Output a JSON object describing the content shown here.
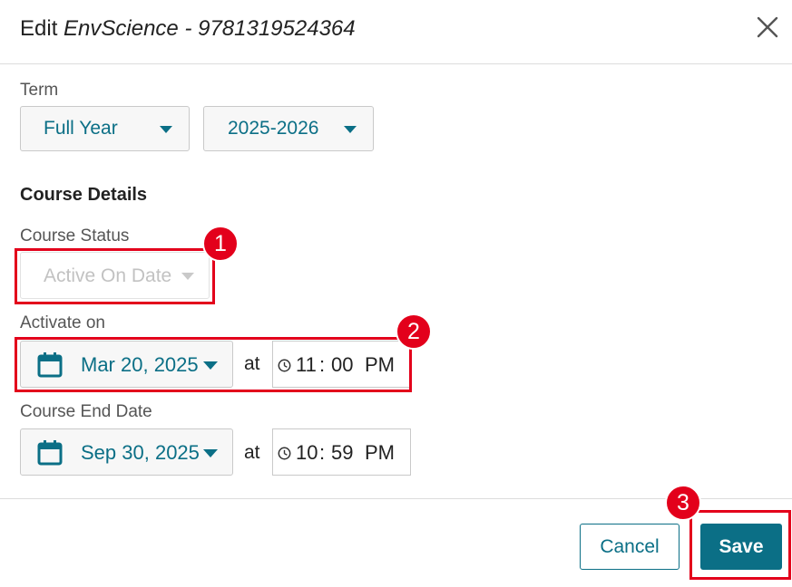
{
  "dialog": {
    "title_prefix": "Edit ",
    "title_name": "EnvScience - 9781319524364"
  },
  "term": {
    "label": "Term",
    "period": "Full Year",
    "year": "2025-2026"
  },
  "course_details": {
    "heading": "Course Details",
    "status_label": "Course Status",
    "status_value": "Active On Date",
    "status_disabled": true
  },
  "activate": {
    "label": "Activate on",
    "date": "Mar 20, 2025",
    "at": "at",
    "hour": "11",
    "sep": ":",
    "minute": "00",
    "ampm": "PM"
  },
  "end": {
    "label": "Course End Date",
    "date": "Sep 30, 2025",
    "at": "at",
    "hour": "10",
    "sep": ":",
    "minute": "59",
    "ampm": "PM"
  },
  "footer": {
    "cancel_label": "Cancel",
    "save_label": "Save"
  },
  "annotations": {
    "badge_1": "1",
    "badge_2": "2",
    "badge_3": "3"
  },
  "colors": {
    "accent": "#0b6f86",
    "highlight": "#e3001b"
  },
  "icons": [
    "close-icon",
    "calendar-icon",
    "clock-icon",
    "chevron-down-icon"
  ]
}
